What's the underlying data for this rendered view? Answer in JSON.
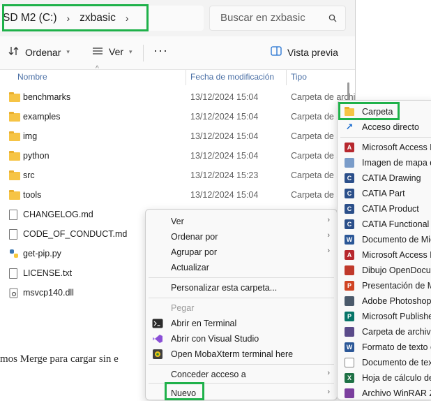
{
  "breadcrumb": {
    "drive": "SD M2 (C:)",
    "sep1": "›",
    "folder": "zxbasic",
    "sep2": "›"
  },
  "search": {
    "placeholder": "Buscar en zxbasic",
    "icon": "search-icon"
  },
  "toolbar": {
    "sort_label": "Ordenar",
    "view_label": "Ver",
    "more_label": "···",
    "preview_label": "Vista previa"
  },
  "columns": {
    "name": "Nombre",
    "modified": "Fecha de modificación",
    "type": "Tipo"
  },
  "files": [
    {
      "name": "benchmarks",
      "date": "13/12/2024 15:04",
      "type": "Carpeta de archivos",
      "kind": "folder"
    },
    {
      "name": "examples",
      "date": "13/12/2024 15:04",
      "type": "Carpeta de archivos",
      "kind": "folder"
    },
    {
      "name": "img",
      "date": "13/12/2024 15:04",
      "type": "Carpeta de archivos",
      "kind": "folder"
    },
    {
      "name": "python",
      "date": "13/12/2024 15:04",
      "type": "Carpeta de archivos",
      "kind": "folder"
    },
    {
      "name": "src",
      "date": "13/12/2024 15:23",
      "type": "Carpeta de archivos",
      "kind": "folder"
    },
    {
      "name": "tools",
      "date": "13/12/2024 15:04",
      "type": "Carpeta de archivos",
      "kind": "folder"
    },
    {
      "name": "CHANGELOG.md",
      "date": "",
      "type": "",
      "kind": "file"
    },
    {
      "name": "CODE_OF_CONDUCT.md",
      "date": "",
      "type": "",
      "kind": "file"
    },
    {
      "name": "get-pip.py",
      "date": "",
      "type": "",
      "kind": "python"
    },
    {
      "name": "LICENSE.txt",
      "date": "",
      "type": "",
      "kind": "file"
    },
    {
      "name": "msvcp140.dll",
      "date": "",
      "type": "",
      "kind": "dll"
    }
  ],
  "background_text": "mos Merge para cargar sin e",
  "context_menu": {
    "ver": "Ver",
    "ordenar": "Ordenar por",
    "agrupar": "Agrupar por",
    "actualizar": "Actualizar",
    "personalizar": "Personalizar esta carpeta...",
    "pegar": "Pegar",
    "terminal": "Abrir en Terminal",
    "vscode": "Abrir con Visual Studio",
    "moba": "Open MobaXterm terminal here",
    "conceder": "Conceder acceso a",
    "nuevo": "Nuevo"
  },
  "submenu": [
    {
      "label": "Carpeta",
      "icon": "folder-icon",
      "color": "#f6c445"
    },
    {
      "label": "Acceso directo",
      "icon": "shortcut-icon",
      "color": "#1f6fd1"
    },
    {
      "label": "Microsoft Access D",
      "icon": "access-icon",
      "color": "#b7282e"
    },
    {
      "label": "Imagen de mapa d",
      "icon": "bitmap-icon",
      "color": "#7a9cc9"
    },
    {
      "label": "CATIA Drawing",
      "icon": "catia-icon",
      "color": "#2b4f8a"
    },
    {
      "label": "CATIA Part",
      "icon": "catia-icon",
      "color": "#2b4f8a"
    },
    {
      "label": "CATIA Product",
      "icon": "catia-icon",
      "color": "#2b4f8a"
    },
    {
      "label": "CATIA Functional S",
      "icon": "catia-icon",
      "color": "#2b4f8a"
    },
    {
      "label": "Documento de Mic",
      "icon": "word-icon",
      "color": "#2b5797"
    },
    {
      "label": "Microsoft Access D",
      "icon": "access-icon",
      "color": "#b7282e"
    },
    {
      "label": "Dibujo OpenDocur",
      "icon": "odg-icon",
      "color": "#c0392b"
    },
    {
      "label": "Presentación de M",
      "icon": "powerpoint-icon",
      "color": "#d04423"
    },
    {
      "label": "Adobe Photoshop",
      "icon": "photoshop-icon",
      "color": "#4b5a6b"
    },
    {
      "label": "Microsoft Publishe",
      "icon": "publisher-icon",
      "color": "#077568"
    },
    {
      "label": "Carpeta de archivo",
      "icon": "archive-icon",
      "color": "#5b4b8a"
    },
    {
      "label": "Formato de texto e",
      "icon": "rtf-icon",
      "color": "#2b5797"
    },
    {
      "label": "Documento de text",
      "icon": "text-icon",
      "color": "#8a8a8a"
    },
    {
      "label": "Hoja de cálculo de",
      "icon": "excel-icon",
      "color": "#1e7145"
    },
    {
      "label": "Archivo WinRAR ZI",
      "icon": "winrar-icon",
      "color": "#7b3f9e"
    }
  ],
  "highlight_color": "#1fb14a"
}
